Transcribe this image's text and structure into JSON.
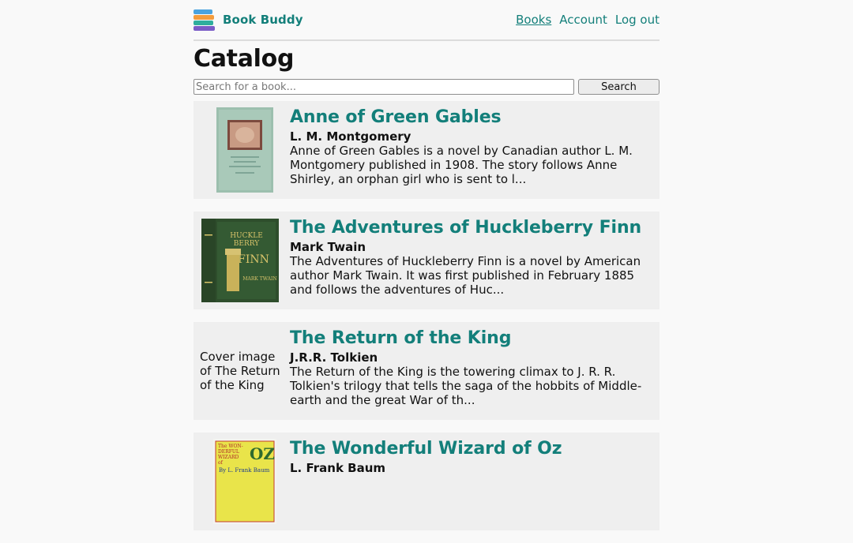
{
  "header": {
    "app_name": "Book Buddy",
    "nav": [
      {
        "label": "Books",
        "active": true
      },
      {
        "label": "Account",
        "active": false
      },
      {
        "label": "Log out",
        "active": false
      }
    ]
  },
  "page_title": "Catalog",
  "search": {
    "placeholder": "Search for a book...",
    "value": "",
    "button_label": "Search"
  },
  "books": [
    {
      "title": "Anne of Green Gables",
      "author": "L. M. Montgomery",
      "description": "Anne of Green Gables is a novel by Canadian author L. M. Montgomery published in 1908. The story follows Anne Shirley, an orphan girl who is sent to l...",
      "cover_alt": ""
    },
    {
      "title": "The Adventures of Huckleberry Finn",
      "author": "Mark Twain",
      "description": "The Adventures of Huckleberry Finn is a novel by American author Mark Twain. It was first published in February 1885 and follows the adventures of Huc...",
      "cover_alt": "",
      "cover_text": [
        "HUCKLEBERRY",
        "FINN",
        "MARK TWAIN"
      ]
    },
    {
      "title": "The Return of the King",
      "author": "J.R.R. Tolkien",
      "description": "The Return of the King is the towering climax to J. R. R. Tolkien's trilogy that tells the saga of the hobbits of Middle-earth and the great War of th...",
      "cover_alt": "Cover image of The Return of the King"
    },
    {
      "title": "The Wonderful Wizard of Oz",
      "author": "L. Frank Baum",
      "description": "",
      "cover_alt": "",
      "cover_text": [
        "The WON-DERFUL WIZARD of OZ",
        "By L. Frank Baum"
      ]
    }
  ],
  "colors": {
    "accent": "#137f7a",
    "background": "#f9f9f9",
    "card": "#efefef"
  }
}
